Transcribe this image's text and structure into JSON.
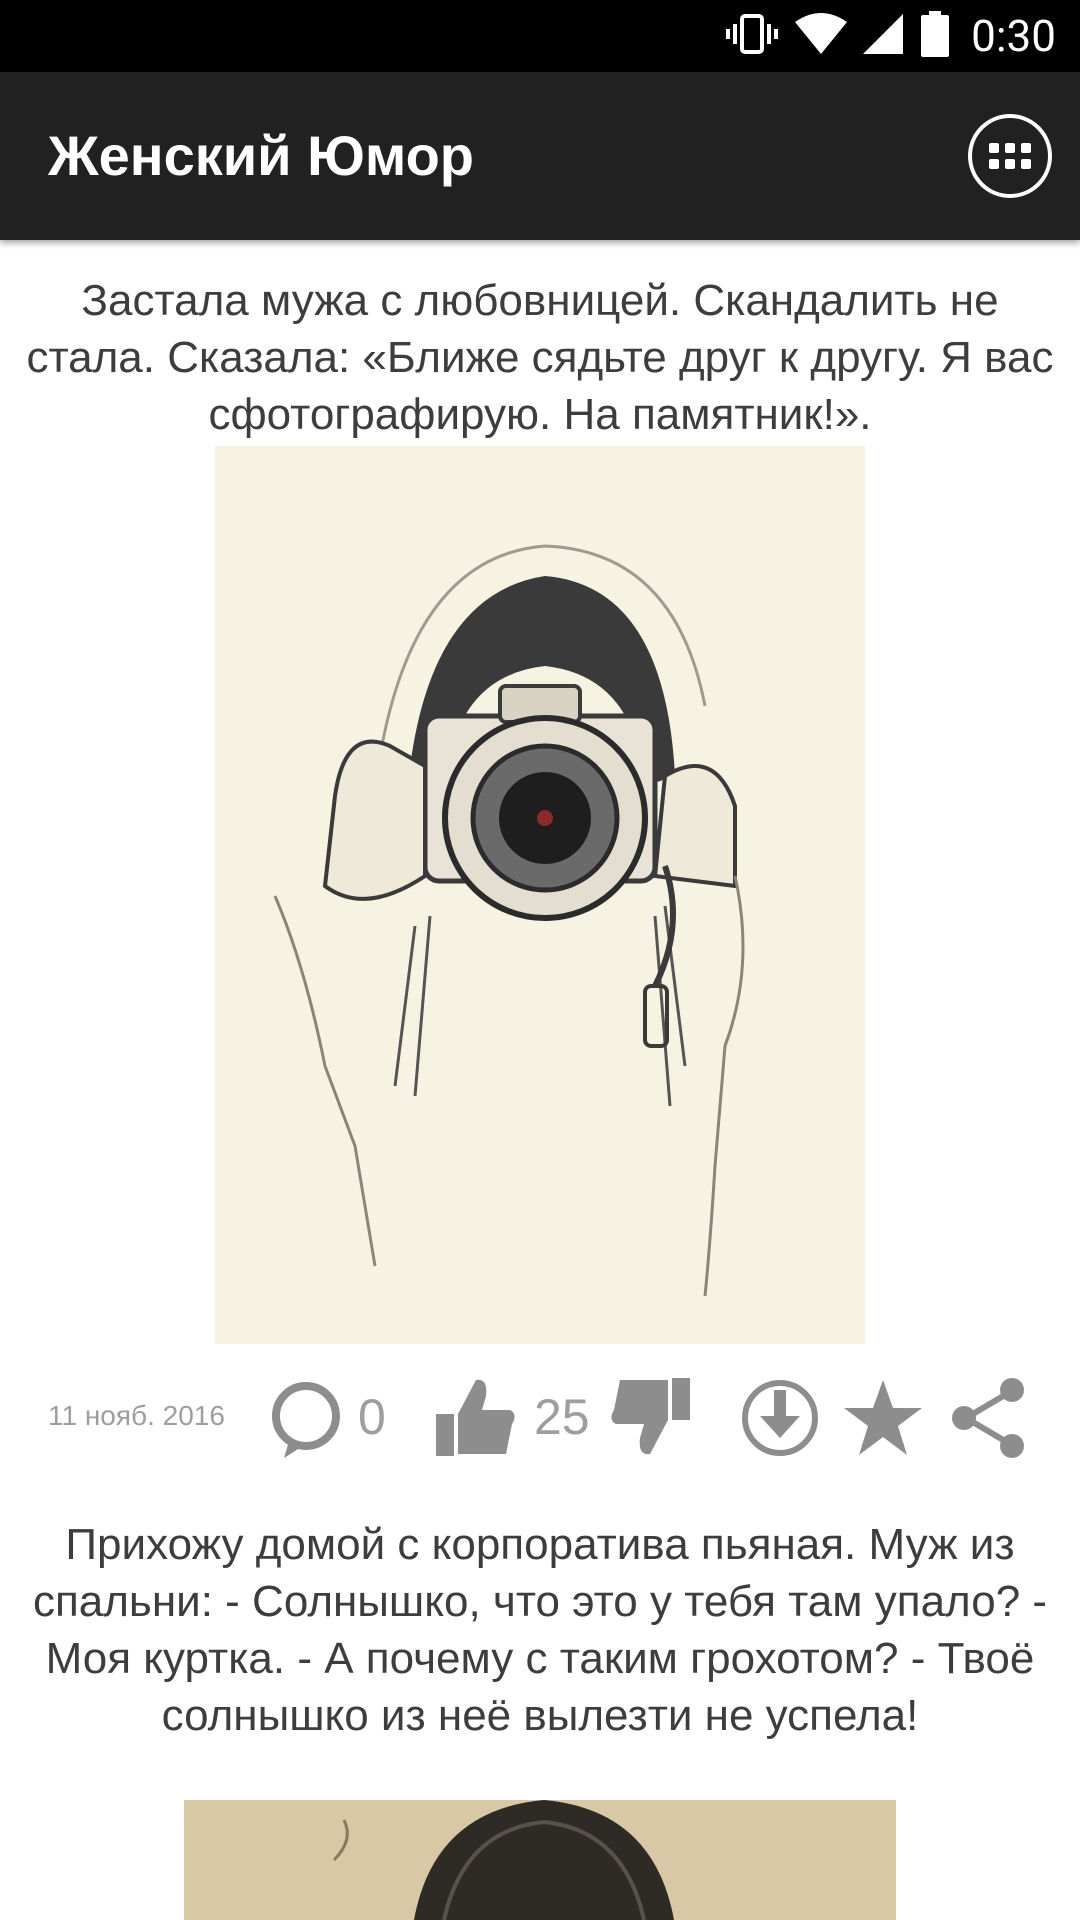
{
  "status_bar": {
    "time": "0:30"
  },
  "app_bar": {
    "title": "Женский Юмор"
  },
  "posts": [
    {
      "text": "Застала мужа с любовницей. Скандалить не стала. Сказала: «Ближе сядьте друг к другу. Я вас сфотографирую. На памятник!».",
      "image_icon": "sketch-girl-camera",
      "date": "11 нояб. 2016",
      "comments": "0",
      "likes": "25"
    },
    {
      "text": "Прихожу домой с корпоратива пьяная. Муж из спальни: - Солнышко, что это у тебя там упало? - Моя куртка. - А почему с таким грохотом? - Твоё солнышко из неё вылезти не успела!",
      "image_icon": "sketch-portrait"
    }
  ],
  "icons": {
    "status": [
      "vibrate-icon",
      "wifi-icon",
      "signal-icon",
      "battery-icon"
    ],
    "menu": "grid-menu-icon",
    "actions": [
      "comment-icon",
      "thumbs-up-icon",
      "thumbs-down-icon",
      "download-icon",
      "star-icon",
      "share-icon"
    ]
  },
  "colors": {
    "app_bar": "#212121",
    "status_bar": "#000000",
    "text": "#3d3d3d",
    "meta": "#9e9e9e"
  }
}
